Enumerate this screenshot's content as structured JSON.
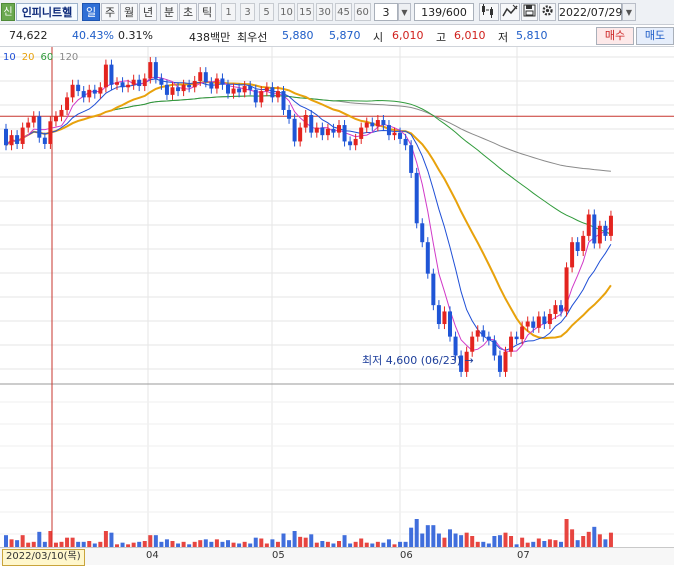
{
  "toolbar": {
    "market_badge": "신",
    "stock_name": "인피니트헬",
    "periods": [
      "일",
      "주",
      "월",
      "년",
      "분",
      "초",
      "틱"
    ],
    "active_period": "일",
    "numbers": [
      "1",
      "3",
      "5",
      "10",
      "15",
      "30",
      "45",
      "60"
    ],
    "count_value": "3",
    "dropdown_glyph": "▼",
    "page_count": "139/600",
    "date_value": "2022/07/29"
  },
  "quote": {
    "price": "74,622",
    "pct_a": "40.43%",
    "pct_b": "0.31%",
    "volume_amount": "438백만",
    "best_sell_label": "최우선",
    "best_sell_1": "5,880",
    "best_sell_2": "5,870",
    "open_label": "시",
    "open": "6,010",
    "high_label": "고",
    "high": "6,010",
    "low_label": "저",
    "low": "5,810",
    "buy_label": "매수",
    "sell_label": "매도"
  },
  "ma_legend": [
    {
      "label": "10",
      "color": "#1f4fd6"
    },
    {
      "label": "20",
      "color": "#e8a20c"
    },
    {
      "label": "60",
      "color": "#2f9a3a"
    },
    {
      "label": "120",
      "color": "#8a8a8a"
    }
  ],
  "annotation": {
    "min_label": "최저 4,600 (06/23)",
    "arrow": "→"
  },
  "date_axis": {
    "crosshair_date": "2022/03/10(목)",
    "months": [
      "04",
      "05",
      "06",
      "07"
    ]
  },
  "colors": {
    "up": "#e3241f",
    "down": "#1f55d6",
    "ma5": "#d13ac8",
    "ma10": "#1f4fd6",
    "ma20": "#e8a20c",
    "ma60": "#2f9a3a",
    "ma120": "#8a8a8a",
    "crosshair": "#c7352e"
  },
  "chart_data": {
    "type": "candlestick",
    "price_axis_range": [
      4500,
      7200
    ],
    "horizontal_reference_price": 6650,
    "min_price": 4600,
    "min_date": "06/23",
    "candles": [
      {
        "o": 6550,
        "c": 6420
      },
      {
        "o": 6420,
        "c": 6500
      },
      {
        "o": 6500,
        "c": 6430
      },
      {
        "o": 6430,
        "c": 6560
      },
      {
        "o": 6560,
        "c": 6600
      },
      {
        "o": 6600,
        "c": 6650
      },
      {
        "o": 6650,
        "c": 6480
      },
      {
        "o": 6480,
        "c": 6430
      },
      {
        "o": 6430,
        "c": 6610
      },
      {
        "o": 6610,
        "c": 6650
      },
      {
        "o": 6650,
        "c": 6700
      },
      {
        "o": 6700,
        "c": 6800
      },
      {
        "o": 6800,
        "c": 6900
      },
      {
        "o": 6900,
        "c": 6850
      },
      {
        "o": 6850,
        "c": 6800
      },
      {
        "o": 6800,
        "c": 6860
      },
      {
        "o": 6860,
        "c": 6830
      },
      {
        "o": 6830,
        "c": 6880
      },
      {
        "o": 6880,
        "c": 7060
      },
      {
        "o": 7060,
        "c": 6900
      },
      {
        "o": 6900,
        "c": 6920
      },
      {
        "o": 6920,
        "c": 6880
      },
      {
        "o": 6880,
        "c": 6900
      },
      {
        "o": 6900,
        "c": 6940
      },
      {
        "o": 6940,
        "c": 6890
      },
      {
        "o": 6890,
        "c": 6950
      },
      {
        "o": 6950,
        "c": 7080
      },
      {
        "o": 7080,
        "c": 6950
      },
      {
        "o": 6950,
        "c": 6900
      },
      {
        "o": 6900,
        "c": 6820
      },
      {
        "o": 6820,
        "c": 6880
      },
      {
        "o": 6880,
        "c": 6850
      },
      {
        "o": 6850,
        "c": 6900
      },
      {
        "o": 6900,
        "c": 6880
      },
      {
        "o": 6880,
        "c": 6930
      },
      {
        "o": 6930,
        "c": 7000
      },
      {
        "o": 7000,
        "c": 6920
      },
      {
        "o": 6920,
        "c": 6870
      },
      {
        "o": 6870,
        "c": 6950
      },
      {
        "o": 6950,
        "c": 6900
      },
      {
        "o": 6900,
        "c": 6830
      },
      {
        "o": 6830,
        "c": 6870
      },
      {
        "o": 6870,
        "c": 6840
      },
      {
        "o": 6840,
        "c": 6890
      },
      {
        "o": 6890,
        "c": 6860
      },
      {
        "o": 6860,
        "c": 6760
      },
      {
        "o": 6760,
        "c": 6850
      },
      {
        "o": 6850,
        "c": 6880
      },
      {
        "o": 6880,
        "c": 6800
      },
      {
        "o": 6800,
        "c": 6850
      },
      {
        "o": 6850,
        "c": 6700
      },
      {
        "o": 6700,
        "c": 6630
      },
      {
        "o": 6630,
        "c": 6450
      },
      {
        "o": 6450,
        "c": 6560
      },
      {
        "o": 6560,
        "c": 6660
      },
      {
        "o": 6660,
        "c": 6520
      },
      {
        "o": 6520,
        "c": 6560
      },
      {
        "o": 6560,
        "c": 6500
      },
      {
        "o": 6500,
        "c": 6550
      },
      {
        "o": 6550,
        "c": 6520
      },
      {
        "o": 6520,
        "c": 6580
      },
      {
        "o": 6580,
        "c": 6450
      },
      {
        "o": 6450,
        "c": 6420
      },
      {
        "o": 6420,
        "c": 6470
      },
      {
        "o": 6470,
        "c": 6560
      },
      {
        "o": 6560,
        "c": 6600
      },
      {
        "o": 6600,
        "c": 6570
      },
      {
        "o": 6570,
        "c": 6620
      },
      {
        "o": 6620,
        "c": 6580
      },
      {
        "o": 6580,
        "c": 6500
      },
      {
        "o": 6500,
        "c": 6520
      },
      {
        "o": 6520,
        "c": 6470
      },
      {
        "o": 6470,
        "c": 6420
      },
      {
        "o": 6420,
        "c": 6200
      },
      {
        "o": 6200,
        "c": 5800
      },
      {
        "o": 5800,
        "c": 5650
      },
      {
        "o": 5650,
        "c": 5400
      },
      {
        "o": 5400,
        "c": 5150
      },
      {
        "o": 5150,
        "c": 5000
      },
      {
        "o": 5000,
        "c": 5100
      },
      {
        "o": 5100,
        "c": 4900
      },
      {
        "o": 4900,
        "c": 4750
      },
      {
        "o": 4750,
        "c": 4620
      },
      {
        "o": 4620,
        "c": 4780
      },
      {
        "o": 4780,
        "c": 4900
      },
      {
        "o": 4900,
        "c": 4950
      },
      {
        "o": 4950,
        "c": 4900
      },
      {
        "o": 4900,
        "c": 4870
      },
      {
        "o": 4870,
        "c": 4750
      },
      {
        "o": 4750,
        "c": 4620
      },
      {
        "o": 4620,
        "c": 4780
      },
      {
        "o": 4780,
        "c": 4900
      },
      {
        "o": 4900,
        "c": 4880
      },
      {
        "o": 4880,
        "c": 4980
      },
      {
        "o": 4980,
        "c": 5020
      },
      {
        "o": 5020,
        "c": 4970
      },
      {
        "o": 4970,
        "c": 5060
      },
      {
        "o": 5060,
        "c": 5000
      },
      {
        "o": 5000,
        "c": 5080
      },
      {
        "o": 5080,
        "c": 5150
      },
      {
        "o": 5150,
        "c": 5100
      },
      {
        "o": 5100,
        "c": 5450
      },
      {
        "o": 5450,
        "c": 5650
      },
      {
        "o": 5650,
        "c": 5580
      },
      {
        "o": 5580,
        "c": 5700
      },
      {
        "o": 5700,
        "c": 5870
      },
      {
        "o": 5870,
        "c": 5640
      },
      {
        "o": 5640,
        "c": 5780
      },
      {
        "o": 5780,
        "c": 5700
      },
      {
        "o": 5700,
        "c": 5860
      }
    ]
  }
}
